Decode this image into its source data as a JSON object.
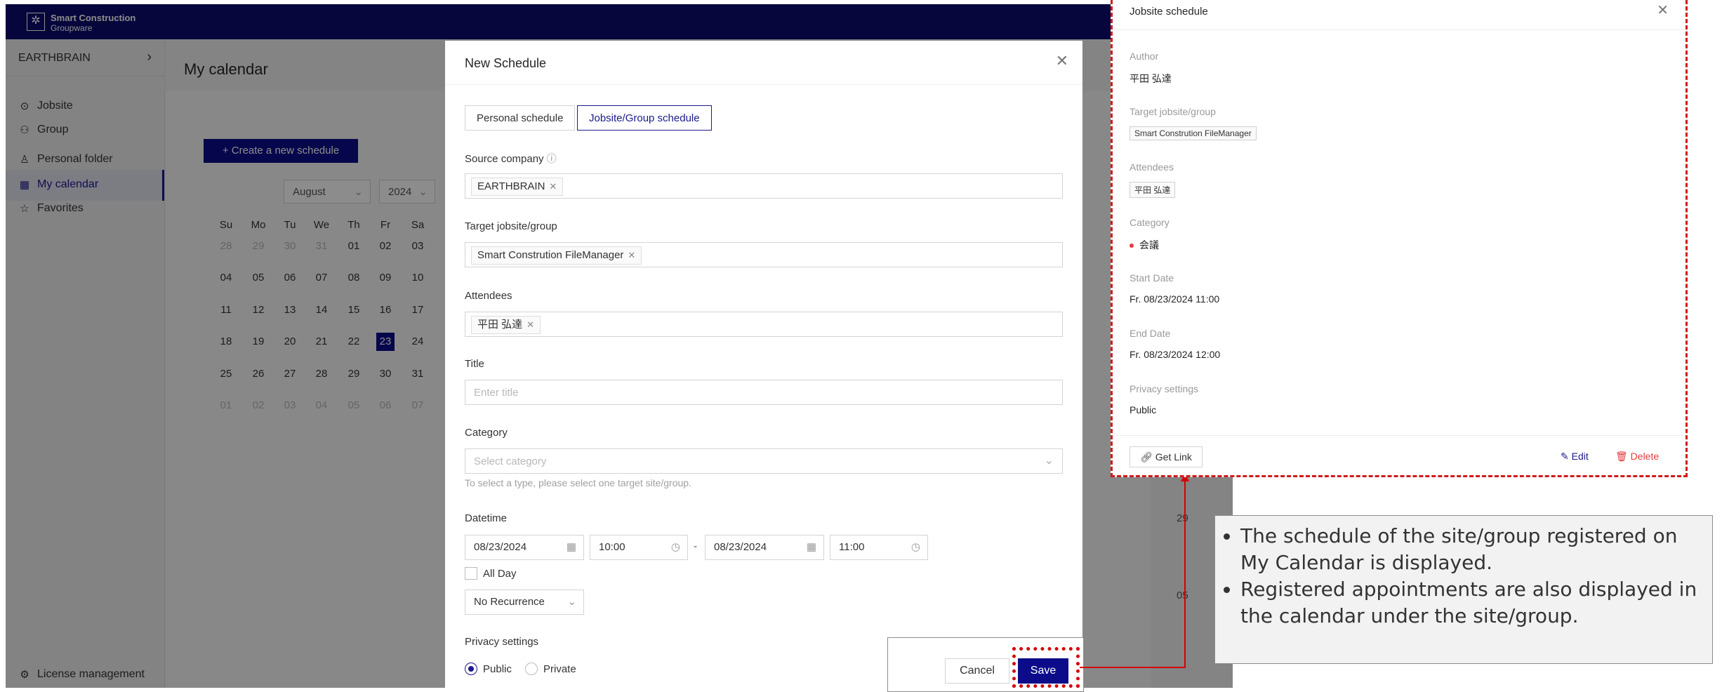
{
  "app": {
    "logo_line1": "Smart Construction",
    "logo_line2": "Groupware",
    "org_name": "EARTHBRAIN",
    "nav": [
      {
        "label": "Jobsite",
        "icon": "location-pin-icon"
      },
      {
        "label": "Group",
        "icon": "group-icon"
      },
      {
        "label": "Personal folder",
        "icon": "person-icon"
      },
      {
        "label": "My calendar",
        "icon": "calendar-icon"
      },
      {
        "label": "Favorites",
        "icon": "star-icon"
      }
    ],
    "license": "License management",
    "page_title": "My calendar",
    "create_button": "+  Create a new schedule",
    "month_select": "August",
    "year_select": "2024",
    "weekdays": [
      "Su",
      "Mo",
      "Tu",
      "We",
      "Th",
      "Fr",
      "Sa"
    ],
    "calendar_rows": [
      [
        "28",
        "29",
        "30",
        "31",
        "01",
        "02",
        "03"
      ],
      [
        "04",
        "05",
        "06",
        "07",
        "08",
        "09",
        "10"
      ],
      [
        "11",
        "12",
        "13",
        "14",
        "15",
        "16",
        "17"
      ],
      [
        "18",
        "19",
        "20",
        "21",
        "22",
        "23",
        "24"
      ],
      [
        "25",
        "26",
        "27",
        "28",
        "29",
        "30",
        "31"
      ],
      [
        "01",
        "02",
        "03",
        "04",
        "05",
        "06",
        "07"
      ]
    ],
    "today": "23",
    "cell_numbers": [
      "29",
      "05"
    ]
  },
  "modal": {
    "title": "New Schedule",
    "tabs": [
      "Personal schedule",
      "Jobsite/Group schedule"
    ],
    "active_tab": "Jobsite/Group schedule",
    "source_company_label": "Source company",
    "source_company_tag": "EARTHBRAIN",
    "target_label": "Target jobsite/group",
    "target_tag": "Smart Constrution FileManager",
    "attendees_label": "Attendees",
    "attendees_tag": "平田 弘達",
    "title_label": "Title",
    "title_placeholder": "Enter title",
    "category_label": "Category",
    "category_placeholder": "Select category",
    "category_hint": "To select a type, please select one target site/group.",
    "datetime_label": "Datetime",
    "start_date": "08/23/2024",
    "start_time": "10:00",
    "dash": "-",
    "end_date": "08/23/2024",
    "end_time": "11:00",
    "all_day": "All Day",
    "recurrence": "No Recurrence",
    "privacy_label": "Privacy settings",
    "privacy_public": "Public",
    "privacy_private": "Private",
    "cancel": "Cancel",
    "save": "Save"
  },
  "detail": {
    "title": "Jobsite schedule",
    "author_label": "Author",
    "author": "平田 弘達",
    "target_label": "Target jobsite/group",
    "target": "Smart Constrution FileManager",
    "attendees_label": "Attendees",
    "attendee": "平田 弘達",
    "category_label": "Category",
    "category": "会議",
    "category_color": "#e03c3c",
    "start_label": "Start Date",
    "start": "Fr. 08/23/2024 11:00",
    "end_label": "End Date",
    "end": "Fr. 08/23/2024 12:00",
    "privacy_label": "Privacy settings",
    "privacy": "Public",
    "get_link": "Get Link",
    "edit": "Edit",
    "delete": "Delete"
  },
  "callout": {
    "points": [
      "The schedule of the site/group registered on My Calendar is displayed.",
      "Registered appointments are also displayed in the calendar under the site/group."
    ]
  },
  "colors": {
    "brand": "#0c0c8a",
    "highlight": "#d60000",
    "danger": "#e03c3c"
  }
}
